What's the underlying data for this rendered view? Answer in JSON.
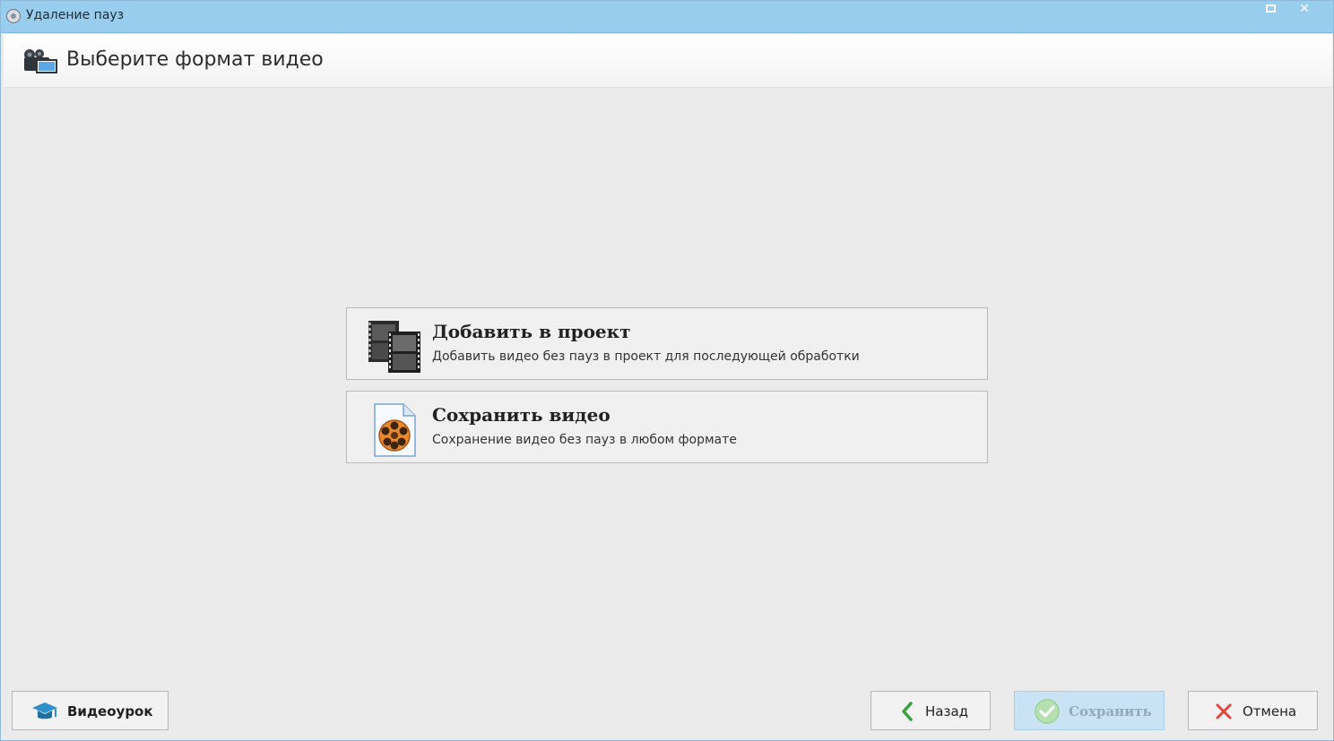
{
  "window": {
    "title": "Удаление пауз",
    "maximize_icon": "maximize-icon",
    "close_icon": "close-icon"
  },
  "header": {
    "title": "Выберите формат видео",
    "icon": "video-camera-icon"
  },
  "options": [
    {
      "title": "Добавить в проект",
      "description": "Добавить видео без пауз в проект для последующей обработки",
      "icon": "film-strips-icon"
    },
    {
      "title": "Сохранить видео",
      "description": "Сохранение видео без пауз в любом формате",
      "icon": "video-file-reel-icon"
    }
  ],
  "footer": {
    "tutorial_label": "Видеоурок",
    "back_label": "Назад",
    "save_label": "Сохранить",
    "cancel_label": "Отмена"
  },
  "colors": {
    "titlebar": "#99cdee",
    "save_disabled_bg": "#c9e3f4",
    "back_arrow": "#3aa140",
    "cancel_x": "#e0463a"
  }
}
